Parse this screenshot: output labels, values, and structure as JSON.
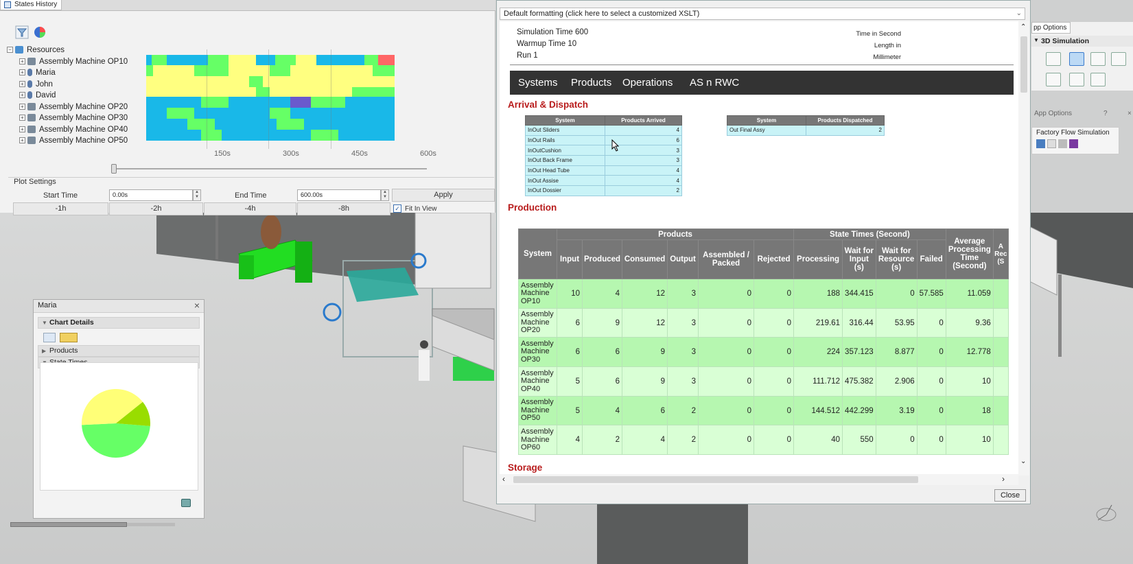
{
  "states_history": {
    "tab_title": "States History",
    "tree_root": "Resources",
    "resources": [
      "Assembly Machine OP10",
      "Maria",
      "John",
      "David",
      "Assembly Machine OP20",
      "Assembly Machine OP30",
      "Assembly Machine OP40",
      "Assembly Machine OP50"
    ],
    "axis_ticks": [
      "150s",
      "300s",
      "450s",
      "600s"
    ],
    "plot_settings": {
      "title": "Plot Settings",
      "start_label": "Start Time",
      "start_value": "0.00s",
      "end_label": "End Time",
      "end_value": "600.00s",
      "apply": "Apply",
      "zoom_buttons": [
        "-1h",
        "-2h",
        "-4h",
        "-8h"
      ],
      "fit_in_view": "Fit In View"
    },
    "colors": {
      "idle": "#ffff80",
      "busy": "#19b8e8",
      "blocked": "#66ff66",
      "failed": "#ff6666",
      "waiting": "#6a5acd"
    }
  },
  "maria_panel": {
    "title": "Maria",
    "chart_details": "Chart Details",
    "products": "Products",
    "state_times": "State Times"
  },
  "pie": {
    "chart_data": {
      "type": "pie",
      "values": [
        48,
        40,
        12
      ],
      "colors": [
        "#66ff66",
        "#ffff77",
        "#99dd00"
      ]
    }
  },
  "report": {
    "format_bar": "Default formatting (click here to select a customized XSLT)",
    "sim_time": "Simulation Time 600",
    "warmup": "Warmup Time 10",
    "run": "Run 1",
    "time_unit": "Time in Second",
    "length_unit": "Length in Millimeter",
    "nav": [
      "Systems",
      "Products",
      "Operations",
      "AS n RWC"
    ],
    "arrival_title": "Arrival & Dispatch",
    "arrival_headers": [
      "System",
      "Products Arrived"
    ],
    "arrivals": [
      {
        "system": "InOut Sliders",
        "value": "4"
      },
      {
        "system": "InOut Rails",
        "value": "6"
      },
      {
        "system": "InOutCushion",
        "value": "3"
      },
      {
        "system": "InOut Back Frame",
        "value": "3"
      },
      {
        "system": "InOut Head Tube",
        "value": "4"
      },
      {
        "system": "InOut Assise",
        "value": "4"
      },
      {
        "system": "InOut Dossier",
        "value": "2"
      }
    ],
    "dispatch_headers": [
      "System",
      "Products Dispatched"
    ],
    "dispatches": [
      {
        "system": "Out Final Assy",
        "value": "2"
      }
    ],
    "production_title": "Production",
    "prod_group_headers": {
      "system": "System",
      "products": "Products",
      "state_times": "State Times (Second)"
    },
    "prod_headers": [
      "Input",
      "Produced",
      "Consumed",
      "Output",
      "Assembled / Packed",
      "Rejected",
      "Processing",
      "Wait for Input (s)",
      "Wait for Resource (s)",
      "Failed",
      "Average Processing Time (Second)",
      "A Rec (S"
    ],
    "production": [
      {
        "system": "Assembly Machine OP10",
        "cells": [
          "10",
          "4",
          "12",
          "3",
          "0",
          "0",
          "188",
          "344.415",
          "0",
          "57.585",
          "11.059"
        ]
      },
      {
        "system": "Assembly Machine OP20",
        "cells": [
          "6",
          "9",
          "12",
          "3",
          "0",
          "0",
          "219.61",
          "316.44",
          "53.95",
          "0",
          "9.36"
        ]
      },
      {
        "system": "Assembly Machine OP30",
        "cells": [
          "6",
          "6",
          "9",
          "3",
          "0",
          "0",
          "224",
          "357.123",
          "8.877",
          "0",
          "12.778"
        ]
      },
      {
        "system": "Assembly Machine OP40",
        "cells": [
          "5",
          "6",
          "9",
          "3",
          "0",
          "0",
          "111.712",
          "475.382",
          "2.906",
          "0",
          "10"
        ]
      },
      {
        "system": "Assembly Machine OP50",
        "cells": [
          "5",
          "4",
          "6",
          "2",
          "0",
          "0",
          "144.512",
          "442.299",
          "3.19",
          "0",
          "18"
        ]
      },
      {
        "system": "Assembly Machine OP60",
        "cells": [
          "4",
          "2",
          "4",
          "2",
          "0",
          "0",
          "40",
          "550",
          "0",
          "0",
          "10"
        ]
      }
    ],
    "storage_title": "Storage",
    "close": "Close"
  },
  "app_options": {
    "tab": "pp Options",
    "group": "3D Simulation",
    "panel_title": "App Options",
    "help": "?",
    "factory_flow": "Factory Flow Simulation"
  }
}
